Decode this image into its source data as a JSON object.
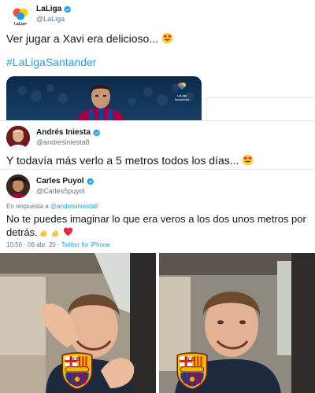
{
  "tweet_laliga": {
    "display_name": "LaLiga",
    "handle": "@LaLiga",
    "text": "Ver jugar a Xavi era delicioso...",
    "hashtag": "#LaLigaSantander",
    "logo_caption": "LaLiga",
    "media_watermark_top": "LaLiga",
    "media_watermark_bottom": "Santander"
  },
  "tweet_iniesta": {
    "display_name": "Andrés Iniesta",
    "handle": "@andresiniesta8",
    "text": "Y todavía más verlo a 5 metros todos los días..."
  },
  "tweet_puyol": {
    "display_name": "Carles Puyol",
    "handle": "@Carles5puyol",
    "reply_prefix": "En respuesta a",
    "reply_to": "@andresiniesta8",
    "text": "No te puedes imaginar lo que era veros a los dos unos metros por detrás.",
    "timestamp": "10:56 · 06 abr. 20 ·",
    "client": "Twitter for iPhone"
  },
  "meme_panels": {
    "left_crest_label": "FCB",
    "right_crest_label": "FCB"
  },
  "colors": {
    "twitter_blue": "#1da1f2",
    "text_primary": "#14171a",
    "text_secondary": "#657786",
    "divider": "#e1e8ed",
    "barca_blue": "#004d98",
    "barca_red": "#a50044"
  },
  "icons": [
    "verified-badge-icon",
    "heart-eyes-emoji-icon",
    "raising-hands-emoji-icon",
    "red-heart-emoji-icon"
  ]
}
